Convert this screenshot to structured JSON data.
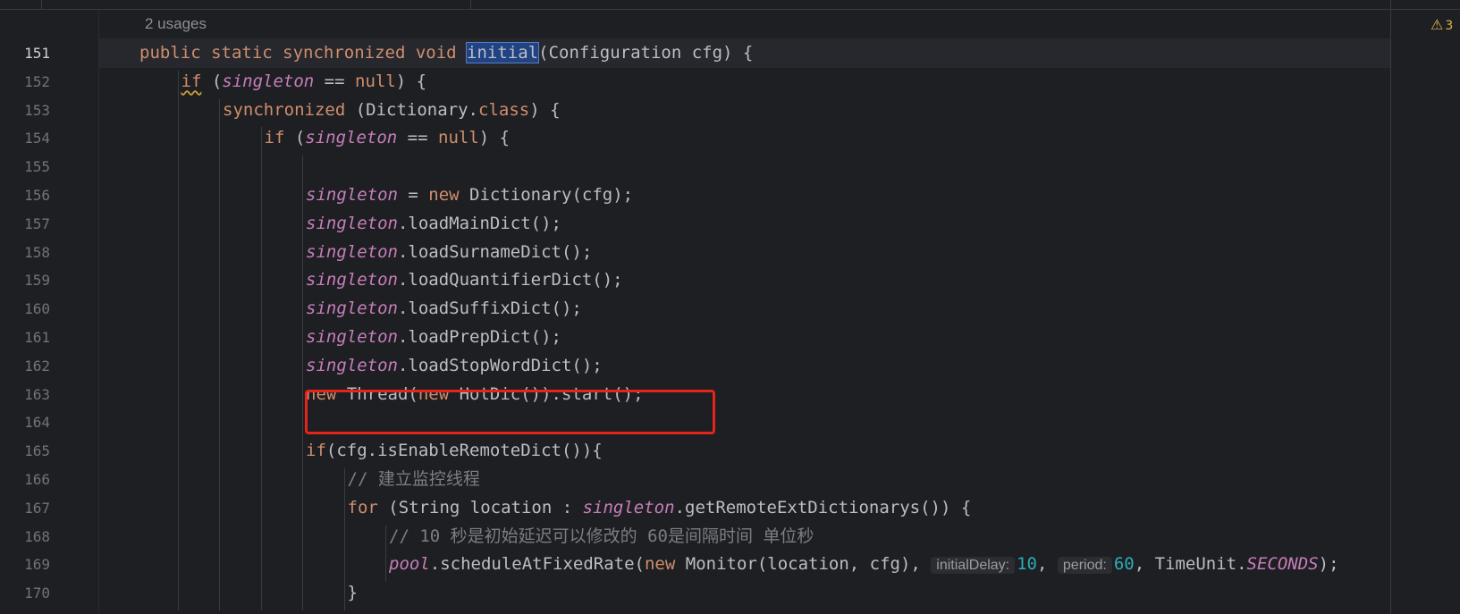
{
  "editor": {
    "usages_hint": "2 usages",
    "warning_count": "3",
    "current_line": 151,
    "lines": [
      {
        "no": "151",
        "indent": 0,
        "tokens": [
          {
            "t": "public static synchronized void ",
            "c": "kw"
          },
          {
            "t": "initial",
            "c": "sel"
          },
          {
            "t": "(Configuration cfg) {",
            "c": ""
          }
        ]
      },
      {
        "no": "152",
        "indent": 1,
        "tokens": [
          {
            "t": "if",
            "c": "kw squig"
          },
          {
            "t": " (",
            "c": ""
          },
          {
            "t": "singleton",
            "c": "fld"
          },
          {
            "t": " == ",
            "c": ""
          },
          {
            "t": "null",
            "c": "kw"
          },
          {
            "t": ") {",
            "c": ""
          }
        ]
      },
      {
        "no": "153",
        "indent": 2,
        "tokens": [
          {
            "t": "synchronized",
            "c": "kw"
          },
          {
            "t": " (Dictionary.",
            "c": ""
          },
          {
            "t": "class",
            "c": "kw"
          },
          {
            "t": ") {",
            "c": ""
          }
        ]
      },
      {
        "no": "154",
        "indent": 3,
        "tokens": [
          {
            "t": "if",
            "c": "kw"
          },
          {
            "t": " (",
            "c": ""
          },
          {
            "t": "singleton",
            "c": "fld"
          },
          {
            "t": " == ",
            "c": ""
          },
          {
            "t": "null",
            "c": "kw"
          },
          {
            "t": ") {",
            "c": ""
          }
        ]
      },
      {
        "no": "155",
        "indent": 4,
        "tokens": []
      },
      {
        "no": "156",
        "indent": 4,
        "tokens": [
          {
            "t": "singleton",
            "c": "fld"
          },
          {
            "t": " = ",
            "c": ""
          },
          {
            "t": "new",
            "c": "kw"
          },
          {
            "t": " Dictionary(cfg);",
            "c": ""
          }
        ]
      },
      {
        "no": "157",
        "indent": 4,
        "tokens": [
          {
            "t": "singleton",
            "c": "fld"
          },
          {
            "t": ".loadMainDict();",
            "c": ""
          }
        ]
      },
      {
        "no": "158",
        "indent": 4,
        "tokens": [
          {
            "t": "singleton",
            "c": "fld"
          },
          {
            "t": ".loadSurnameDict();",
            "c": ""
          }
        ]
      },
      {
        "no": "159",
        "indent": 4,
        "tokens": [
          {
            "t": "singleton",
            "c": "fld"
          },
          {
            "t": ".loadQuantifierDict();",
            "c": ""
          }
        ]
      },
      {
        "no": "160",
        "indent": 4,
        "tokens": [
          {
            "t": "singleton",
            "c": "fld"
          },
          {
            "t": ".loadSuffixDict();",
            "c": ""
          }
        ]
      },
      {
        "no": "161",
        "indent": 4,
        "tokens": [
          {
            "t": "singleton",
            "c": "fld"
          },
          {
            "t": ".loadPrepDict();",
            "c": ""
          }
        ]
      },
      {
        "no": "162",
        "indent": 4,
        "tokens": [
          {
            "t": "singleton",
            "c": "fld"
          },
          {
            "t": ".loadStopWordDict();",
            "c": ""
          }
        ]
      },
      {
        "no": "163",
        "indent": 4,
        "tokens": [
          {
            "t": "new",
            "c": "kw"
          },
          {
            "t": " Thread(",
            "c": ""
          },
          {
            "t": "new",
            "c": "kw"
          },
          {
            "t": " HotDic()).start();",
            "c": ""
          }
        ]
      },
      {
        "no": "164",
        "indent": 4,
        "tokens": []
      },
      {
        "no": "165",
        "indent": 4,
        "tokens": [
          {
            "t": "if",
            "c": "kw"
          },
          {
            "t": "(cfg.isEnableRemoteDict()){",
            "c": ""
          }
        ]
      },
      {
        "no": "166",
        "indent": 5,
        "tokens": [
          {
            "t": "// 建立监控线程",
            "c": "cmt"
          }
        ]
      },
      {
        "no": "167",
        "indent": 5,
        "tokens": [
          {
            "t": "for",
            "c": "kw"
          },
          {
            "t": " (String location : ",
            "c": ""
          },
          {
            "t": "singleton",
            "c": "fld"
          },
          {
            "t": ".getRemoteExtDictionarys()) {",
            "c": ""
          }
        ]
      },
      {
        "no": "168",
        "indent": 6,
        "tokens": [
          {
            "t": "// 10 秒是初始延迟可以修改的 60是间隔时间 单位秒",
            "c": "cmt"
          }
        ]
      },
      {
        "no": "169",
        "indent": 6,
        "tokens": [
          {
            "t": "pool",
            "c": "fld"
          },
          {
            "t": ".scheduleAtFixedRate(",
            "c": ""
          },
          {
            "t": "new",
            "c": "kw"
          },
          {
            "t": " Monitor(location, cfg), ",
            "c": ""
          },
          {
            "t": "initialDelay:",
            "c": "hint"
          },
          {
            "t": "10",
            "c": "num"
          },
          {
            "t": ", ",
            "c": ""
          },
          {
            "t": "period:",
            "c": "hint"
          },
          {
            "t": "60",
            "c": "num"
          },
          {
            "t": ", TimeUnit.",
            "c": ""
          },
          {
            "t": "SECONDS",
            "c": "fld"
          },
          {
            "t": ");",
            "c": ""
          }
        ]
      },
      {
        "no": "170",
        "indent": 5,
        "tokens": [
          {
            "t": "}",
            "c": ""
          }
        ]
      }
    ]
  }
}
